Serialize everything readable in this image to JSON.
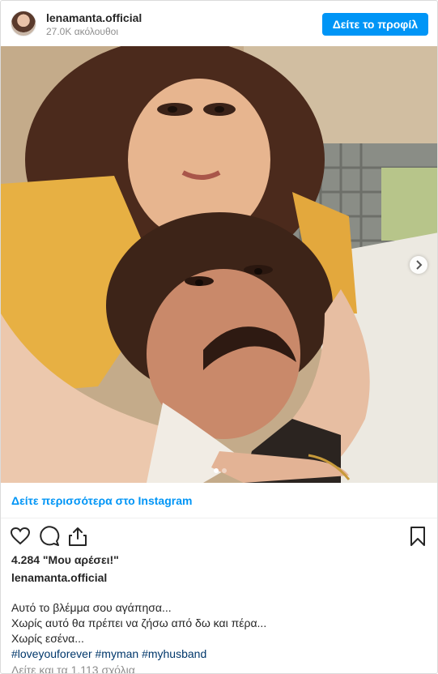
{
  "header": {
    "username": "lenamanta.official",
    "followers": "27.0K ακόλουθοι",
    "profile_button": "Δείτε το προφίλ"
  },
  "post": {
    "image_description": "vintage photo of a woman hugging a mustached man",
    "carousel": {
      "count": 2,
      "active_index": 0
    }
  },
  "see_more": "Δείτε περισσότερα στο Instagram",
  "actions": {
    "icons": [
      "heart-icon",
      "comment-icon",
      "share-icon",
      "bookmark-icon"
    ]
  },
  "likes": "4.284 \"Μου αρέσει!\"",
  "caption": {
    "username": "lenamanta.official",
    "lines": [
      "Αυτό το βλέμμα σου αγάπησα...",
      "Χωρίς αυτό θα πρέπει να ζήσω από δω και πέρα...",
      "Χωρίς εσένα..."
    ],
    "hashtags": "#loveyouforever #myman #myhusband"
  },
  "comments": "Δείτε και τα 1.113 σχόλια",
  "colors": {
    "accent": "#0095f6",
    "text": "#262626",
    "muted": "#8e8e8e",
    "hashtag": "#00376b"
  }
}
